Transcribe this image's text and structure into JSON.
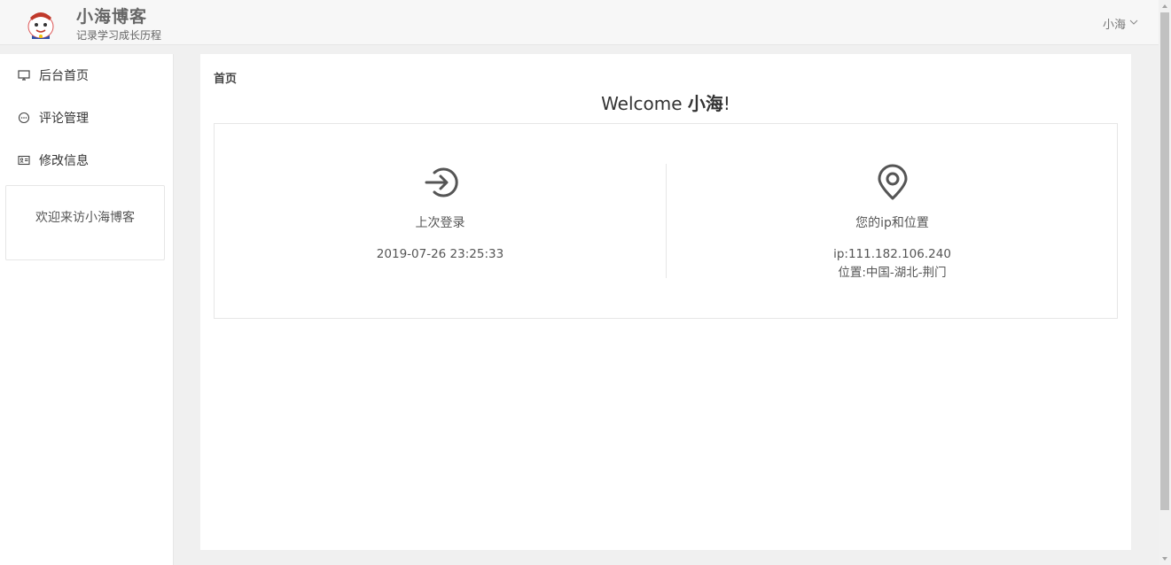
{
  "header": {
    "title": "小海博客",
    "subtitle": "记录学习成长历程",
    "user_name": "小海"
  },
  "sidebar": {
    "items": [
      {
        "label": "后台首页",
        "icon": "monitor-icon"
      },
      {
        "label": "评论管理",
        "icon": "chat-icon"
      },
      {
        "label": "修改信息",
        "icon": "id-card-icon"
      }
    ],
    "welcome_text": "欢迎来访小海博客"
  },
  "main": {
    "breadcrumb": "首页",
    "welcome_prefix": "Welcome ",
    "welcome_name": "小海",
    "welcome_suffix": "!",
    "last_login": {
      "label": "上次登录",
      "value": "2019-07-26 23:25:33",
      "icon": "login-arrow-icon"
    },
    "location": {
      "label": "您的ip和位置",
      "ip": "ip:111.182.106.240",
      "place": "位置:中国-湖北-荆门",
      "icon": "location-pin-icon"
    }
  }
}
